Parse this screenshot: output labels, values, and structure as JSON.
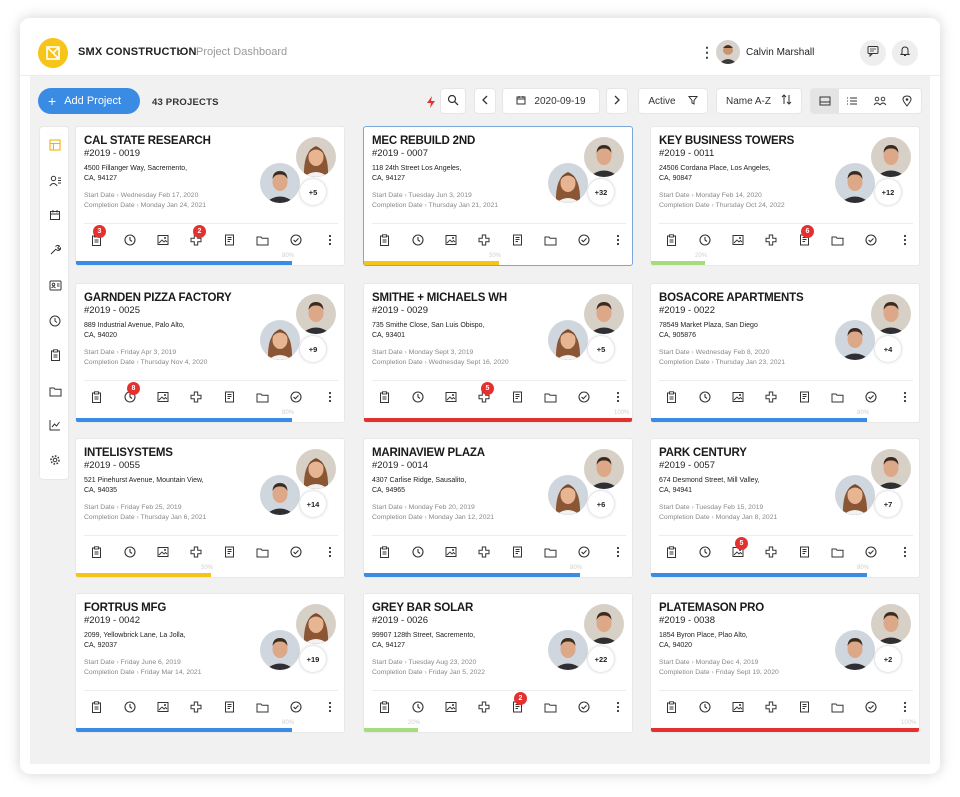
{
  "header": {
    "brand": "SMX CONSTRUCTION",
    "breadcrumb_sep": "›",
    "breadcrumb": "Project Dashboard",
    "user_name": "Calvin Marshall",
    "icons": [
      "logo-icon",
      "more-vertical-icon",
      "chat-icon",
      "bell-icon"
    ]
  },
  "toolbar": {
    "add_label": "Add Project",
    "add_icon": "+",
    "project_count": "43 PROJECTS",
    "date": "2020-09-19",
    "status_filter": "Active",
    "sort": "Name A-Z",
    "flash_color": "#e53030",
    "accent": "#3a8be4"
  },
  "sidebar_icons": [
    "dashboard-icon",
    "users-icon",
    "calendar-icon",
    "wrench-icon",
    "id-card-icon",
    "clock-icon",
    "clipboard-icon",
    "folder-icon",
    "chart-icon",
    "settings-icon"
  ],
  "colors": {
    "blue": "#3a8be4",
    "yellow": "#f4c518",
    "green": "#a6dd7a",
    "red": "#e53030"
  },
  "projects": [
    {
      "title": "CAL STATE RESEARCH",
      "number": "#2019 - 0019",
      "addr1": "4500 Fillanger Way, Sacremento,",
      "addr2": "CA, 94127",
      "start_label": "Start Date",
      "start": "Wednesday Feb 17, 2020",
      "end_label": "Completion Date",
      "end": "Monday Jan 24, 2021",
      "team": "+5",
      "progress": 80,
      "pct": "80%",
      "color": "blue",
      "badges": [
        {
          "pos": 0,
          "n": "3"
        },
        {
          "pos": 3,
          "n": "2"
        }
      ],
      "av": [
        "f",
        "m"
      ]
    },
    {
      "title": "MEC REBUILD 2ND",
      "number": "#2019 - 0007",
      "addr1": "118 24th Street Los Angeles,",
      "addr2": "CA, 94127",
      "start_label": "Start Date",
      "start": "Tuesday Jun 3, 2019",
      "end_label": "Completion Date",
      "end": "Thursday Jan 21, 2021",
      "team": "+32",
      "progress": 50,
      "pct": "50%",
      "color": "yellow",
      "badges": [],
      "av": [
        "m",
        "f"
      ],
      "selected": true
    },
    {
      "title": "KEY BUSINESS TOWERS",
      "number": "#2019 - 0011",
      "addr1": "24506 Cordana Place, Los Angeles,",
      "addr2": "CA, 90847",
      "start_label": "Start Date",
      "start": "Monday Feb 14, 2020",
      "end_label": "Completion Date",
      "end": "Thursday Oct 24, 2022",
      "team": "+12",
      "progress": 20,
      "pct": "20%",
      "color": "green",
      "badges": [
        {
          "pos": 4,
          "n": "6"
        }
      ],
      "av": [
        "m",
        "m"
      ]
    },
    {
      "title": "GARNDEN PIZZA FACTORY",
      "number": "#2019 - 0025",
      "addr1": "889 Industrial Avenue, Palo Alto,",
      "addr2": "CA, 94020",
      "start_label": "Start Date",
      "start": "Friday Apr 3, 2019",
      "end_label": "Completion Date",
      "end": "Thursday Nov 4, 2020",
      "team": "+9",
      "progress": 80,
      "pct": "80%",
      "color": "blue",
      "badges": [
        {
          "pos": 1,
          "n": "8"
        }
      ],
      "av": [
        "m",
        "f"
      ]
    },
    {
      "title": "SMITHE + MICHAELS WH",
      "number": "#2019 - 0029",
      "addr1": "735 Smithe Close, San Luis Obispo,",
      "addr2": "CA, 93401",
      "start_label": "Start Date",
      "start": "Monday Sept 3, 2019",
      "end_label": "Completion Date",
      "end": "Wednesday Sept 16, 2020",
      "team": "+5",
      "progress": 100,
      "pct": "100%",
      "color": "red",
      "badges": [
        {
          "pos": 3,
          "n": "5"
        }
      ],
      "av": [
        "m",
        "f"
      ]
    },
    {
      "title": "BOSACORE APARTMENTS",
      "number": "#2019 - 0022",
      "addr1": "78549 Market Plaza, San Diego",
      "addr2": "CA, 905876",
      "start_label": "Start Date",
      "start": "Wednesday Feb 8, 2020",
      "end_label": "Completion Date",
      "end": "Thursday Jan 23, 2021",
      "team": "+4",
      "progress": 80,
      "pct": "80%",
      "color": "blue",
      "badges": [],
      "av": [
        "m",
        "m"
      ]
    },
    {
      "title": "INTELISYSTEMS",
      "number": "#2019 - 0055",
      "addr1": "521 Pinehurst Avenue, Mountain View,",
      "addr2": "CA, 94035",
      "start_label": "Start Date",
      "start": "Friday Feb 25, 2019",
      "end_label": "Completion Date",
      "end": "Thursday Jan 6, 2021",
      "team": "+14",
      "progress": 50,
      "pct": "50%",
      "color": "yellow",
      "badges": [],
      "av": [
        "f",
        "m"
      ]
    },
    {
      "title": "MARINAVIEW PLAZA",
      "number": "#2019 - 0014",
      "addr1": "4307 Carlise Ridge, Sausalito,",
      "addr2": "CA, 94965",
      "start_label": "Start Date",
      "start": "Monday Feb 20, 2019",
      "end_label": "Completion Date",
      "end": "Monday Jan 12, 2021",
      "team": "+6",
      "progress": 80,
      "pct": "80%",
      "color": "blue",
      "badges": [],
      "av": [
        "m",
        "f"
      ]
    },
    {
      "title": "PARK CENTURY",
      "number": "#2019 - 0057",
      "addr1": "674 Desmond Street, Mill Valley,",
      "addr2": "CA, 94941",
      "start_label": "Start Date",
      "start": "Tuesday Feb 15, 2019",
      "end_label": "Completion Date",
      "end": "Monday Jan 8, 2021",
      "team": "+7",
      "progress": 80,
      "pct": "80%",
      "color": "blue",
      "badges": [
        {
          "pos": 2,
          "n": "5"
        }
      ],
      "av": [
        "m",
        "f"
      ]
    },
    {
      "title": "FORTRUS MFG",
      "number": "#2019 - 0042",
      "addr1": "2099, Yellowbrick Lane, La Jolla,",
      "addr2": "CA, 92037",
      "start_label": "Start Date",
      "start": "Friday June 6, 2019",
      "end_label": "Completion Date",
      "end": "Friday Mar 14, 2021",
      "team": "+19",
      "progress": 80,
      "pct": "80%",
      "color": "blue",
      "badges": [],
      "av": [
        "f",
        "m"
      ]
    },
    {
      "title": "GREY BAR SOLAR",
      "number": "#2019 - 0026",
      "addr1": "99907 128th Street, Sacremento,",
      "addr2": "CA, 94127",
      "start_label": "Start Date",
      "start": "Tuesday Aug 23, 2020",
      "end_label": "Completion Date",
      "end": "Friday Jan 5, 2022",
      "team": "+22",
      "progress": 20,
      "pct": "20%",
      "color": "green",
      "badges": [
        {
          "pos": 4,
          "n": "2"
        }
      ],
      "av": [
        "m",
        "m"
      ]
    },
    {
      "title": "PLATEMASON PRO",
      "number": "#2019 - 0038",
      "addr1": "1854 Byron Place, Plao Alto,",
      "addr2": "CA, 94020",
      "start_label": "Start Date",
      "start": "Monday Dec 4, 2019",
      "end_label": "Completion Date",
      "end": "Friday Sept 19, 2020",
      "team": "+2",
      "progress": 100,
      "pct": "100%",
      "color": "red",
      "badges": [],
      "av": [
        "m",
        "m"
      ]
    }
  ],
  "card_icon_names": [
    "clipboard-icon",
    "clock-icon",
    "image-icon",
    "medical-plus-icon",
    "document-icon",
    "folder-icon",
    "check-circle-icon",
    "more-vertical-icon"
  ]
}
